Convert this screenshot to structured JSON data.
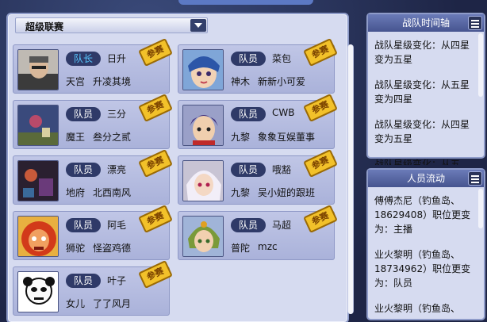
{
  "league": {
    "selected": "超级联赛"
  },
  "members": [
    {
      "role": "队长",
      "name": "日升",
      "realm": "天宫",
      "nick": "升凌其境",
      "stamp": "参赛",
      "role_type": "captain"
    },
    {
      "role": "队员",
      "name": "菜包",
      "realm": "神木",
      "nick": "新新小可爱",
      "stamp": "参赛",
      "role_type": "member"
    },
    {
      "role": "队员",
      "name": "三分",
      "realm": "魔王",
      "nick": "叁分之贰",
      "stamp": "参赛",
      "role_type": "member"
    },
    {
      "role": "队员",
      "name": "CWB",
      "realm": "九黎",
      "nick": "象象互娱董事",
      "stamp": "参赛",
      "role_type": "member"
    },
    {
      "role": "队员",
      "name": "漂亮",
      "realm": "地府",
      "nick": "北西南风",
      "stamp": "参赛",
      "role_type": "member"
    },
    {
      "role": "队员",
      "name": "哦豁",
      "realm": "九黎",
      "nick": "吴小妞的跟班",
      "stamp": "参赛",
      "role_type": "member"
    },
    {
      "role": "队员",
      "name": "阿毛",
      "realm": "狮驼",
      "nick": "怪盗鸡德",
      "stamp": "参赛",
      "role_type": "member"
    },
    {
      "role": "队员",
      "name": "马超",
      "realm": "普陀",
      "nick": "mzc",
      "stamp": "参赛",
      "role_type": "member"
    },
    {
      "role": "队员",
      "name": "叶子",
      "realm": "女儿",
      "nick": "了了风月",
      "stamp": "参赛",
      "role_type": "member"
    }
  ],
  "timeline": {
    "title": "战队时间轴",
    "entries": [
      "战队星级变化：从四星变为五星",
      "战队星级变化：从五星变为四星",
      "战队星级变化：从四星变为五星",
      "战队星级变化：从五"
    ]
  },
  "personnel": {
    "title": "人员流动",
    "entries": [
      "傅傅杰尼（钓鱼岛、18629408）职位更变为：主播",
      "业火黎明（钓鱼岛、18734962）职位更变为：队员",
      "业火黎明（钓鱼岛、"
    ]
  },
  "avatar_icons": [
    "avatar-old-man",
    "avatar-blue-hair-girl",
    "avatar-dark-scene",
    "avatar-purple-hair-boy",
    "avatar-demon-scene",
    "avatar-white-hair-girl",
    "avatar-lion-demon",
    "avatar-green-hair-girl",
    "avatar-panda-meme"
  ],
  "colors": {
    "panel": "#d6dbf0",
    "card": "#b4bbe0",
    "role_badge": "#2f3a68",
    "stamp": "#f2c12a",
    "header": "#46548f"
  }
}
